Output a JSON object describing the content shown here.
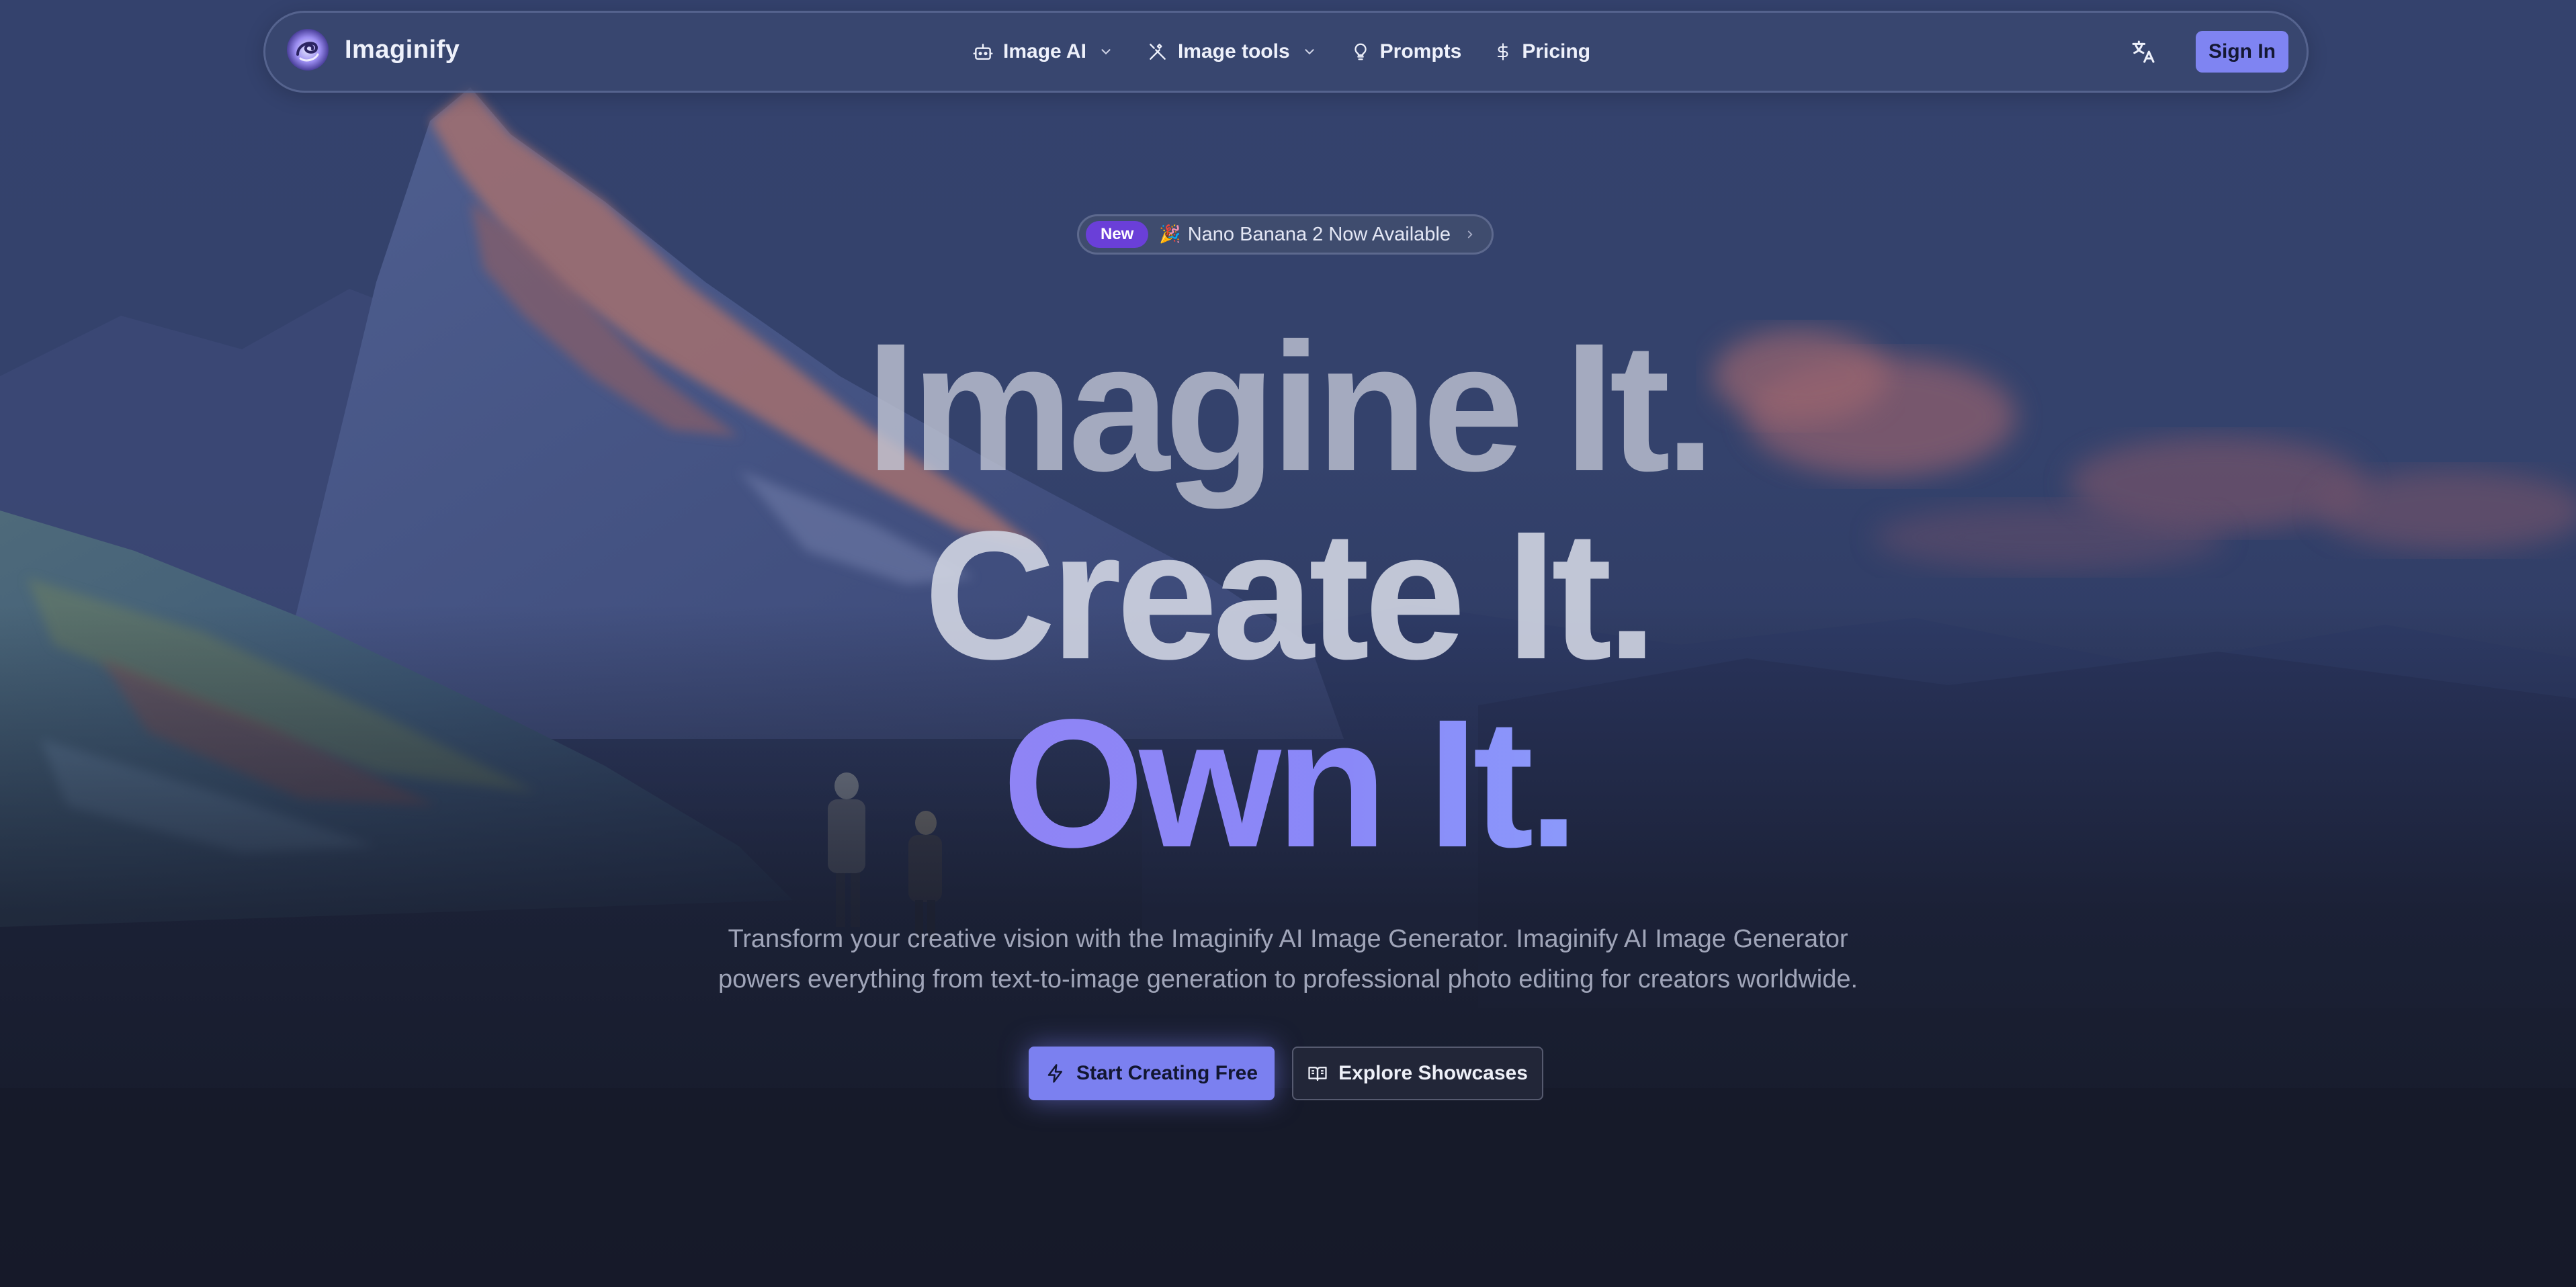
{
  "nav": {
    "brand_name": "Imaginify",
    "links": [
      {
        "label": "Image AI",
        "icon": "robot-icon",
        "has_dropdown": true
      },
      {
        "label": "Image tools",
        "icon": "tools-icon",
        "has_dropdown": true
      },
      {
        "label": "Prompts",
        "icon": "lightbulb-icon",
        "has_dropdown": false
      },
      {
        "label": "Pricing",
        "icon": "dollar-icon",
        "has_dropdown": false
      }
    ],
    "translate_icon": "translate-icon",
    "sign_in_label": "Sign In"
  },
  "badge": {
    "tag": "New",
    "emoji": "🎉",
    "text": "Nano Banana 2 Now Available"
  },
  "hero": {
    "line1": "Imagine It.",
    "line2": "Create It.",
    "line3": "Own It.",
    "subtitle_line1": "Transform your creative vision with the Imaginify AI Image Generator. Imaginify AI Image Generator",
    "subtitle_line2": "powers everything from text-to-image generation to professional photo editing for creators worldwide."
  },
  "cta": {
    "primary_label": "Start Creating Free",
    "primary_icon": "lightning-icon",
    "secondary_label": "Explore Showcases",
    "secondary_icon": "book-icon"
  },
  "colors": {
    "accent": "#7f84f2",
    "badge_tag": "#6a3fd8",
    "page_bg": "#161a29"
  }
}
